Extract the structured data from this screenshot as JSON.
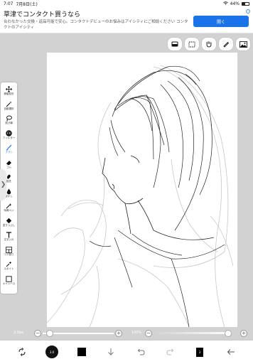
{
  "status": {
    "time": "7:07",
    "date": "7月8日(土)",
    "battery": "44%",
    "battery_level": 0.44
  },
  "ad": {
    "title": "草津でコンタクト買うなら",
    "description": "合わなかった交換・返品可能で安心。コンタクトデビューのお悩みはアイシティにご相談ください コンタクトのアイシティ",
    "button": "開く",
    "info": "i"
  },
  "top_tools": [
    "eraser-icon",
    "selection-icon",
    "hand-icon",
    "pen-icon",
    "image-icon"
  ],
  "toolbar": {
    "tools": [
      {
        "id": "move",
        "label": "移動変形",
        "icon": "move-icon"
      },
      {
        "id": "magic",
        "label": "自動選択",
        "icon": "magic-wand-icon"
      },
      {
        "id": "lasso",
        "label": "投げ縄",
        "icon": "lasso-icon"
      },
      {
        "id": "filter",
        "label": "フィルター",
        "icon": "filter-icon"
      },
      {
        "id": "brush",
        "label": "ブラシ",
        "icon": "brush-icon",
        "active": true
      },
      {
        "id": "eraser",
        "label": "ゴム",
        "icon": "eraser-icon"
      },
      {
        "id": "smudge",
        "label": "指先",
        "icon": "smudge-icon"
      },
      {
        "id": "blur",
        "label": "ぼかし",
        "icon": "blur-icon"
      },
      {
        "id": "special",
        "label": "特殊ペン",
        "icon": "special-pen-icon"
      },
      {
        "id": "fill",
        "label": "塗りつぶし",
        "icon": "fill-icon"
      },
      {
        "id": "text",
        "label": "文字入れ",
        "icon": "text-icon"
      },
      {
        "id": "frame",
        "label": "コマ割り",
        "icon": "frame-icon"
      },
      {
        "id": "eyedropper",
        "label": "スポイト",
        "icon": "eyedropper-icon"
      },
      {
        "id": "canvas",
        "label": "キャンバス",
        "icon": "canvas-icon"
      }
    ]
  },
  "sliders": {
    "size_value": "3.0px",
    "size_level": 0.05,
    "opacity_value": "100%",
    "opacity_level": 1.0,
    "minus": "−",
    "plus": "+"
  },
  "bottom": {
    "brush_size_label": "3.0",
    "layer_label": "3"
  }
}
